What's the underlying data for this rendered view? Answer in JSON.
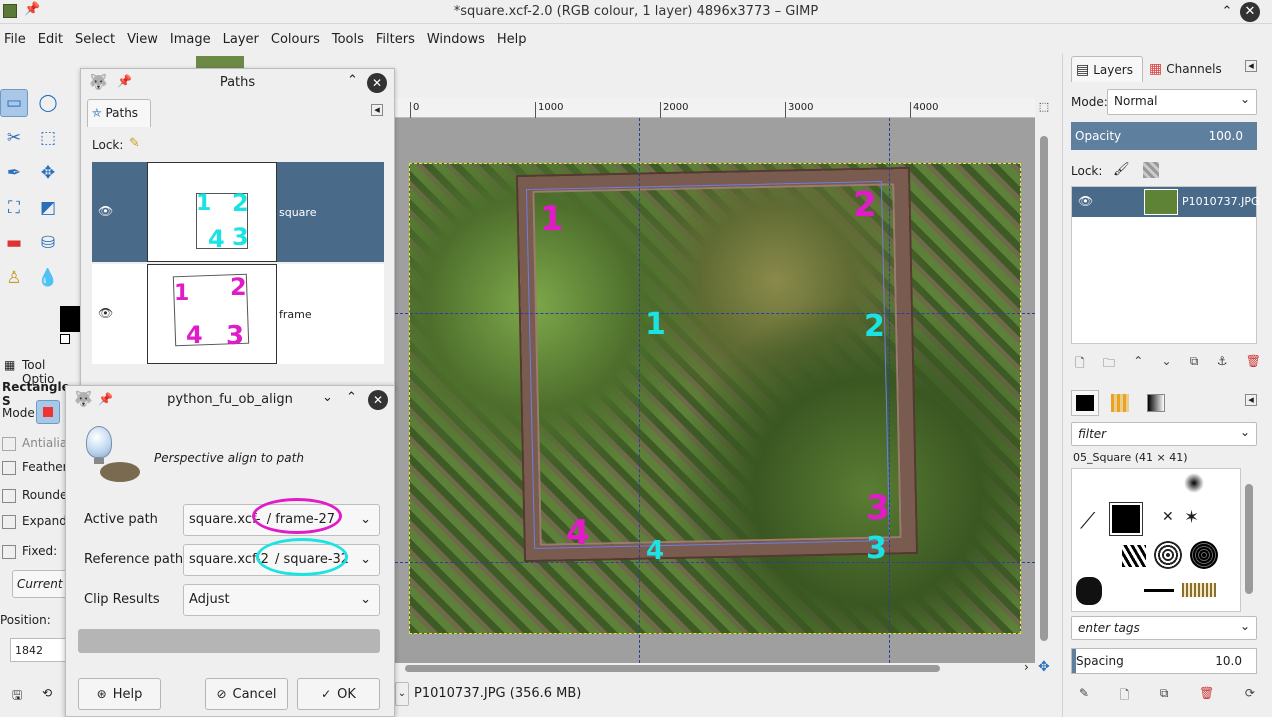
{
  "window": {
    "title": "*square.xcf-2.0 (RGB colour, 1 layer) 4896x3773 – GIMP"
  },
  "menu": [
    "File",
    "Edit",
    "Select",
    "View",
    "Image",
    "Layer",
    "Colours",
    "Tools",
    "Filters",
    "Windows",
    "Help"
  ],
  "ruler": {
    "ticks": [
      "0",
      "1000",
      "2000",
      "3000",
      "4000"
    ]
  },
  "annotations": {
    "magenta": [
      "1",
      "2",
      "3",
      "4"
    ],
    "cyan": [
      "1",
      "2",
      "3",
      "4"
    ]
  },
  "status": {
    "layer_info": "P1010737.JPG (356.6 MB)"
  },
  "paths_dialog": {
    "title": "Paths",
    "tab": "Paths",
    "lock_label": "Lock:",
    "items": [
      {
        "name": "square",
        "thumb_digits": [
          "1",
          "2",
          "4",
          "3"
        ]
      },
      {
        "name": "frame",
        "thumb_digits": [
          "1",
          "2",
          "4",
          "3"
        ]
      }
    ]
  },
  "toolbox": {
    "tool_options_label": "Tool Optio",
    "rect_select_label": "Rectangle S",
    "mode_label": "Mode:",
    "options": [
      "Antialia",
      "Feather",
      "Rounde",
      "Expand",
      "Fixed:"
    ],
    "current_label": "Current",
    "position_label": "Position:",
    "position_value": "1842"
  },
  "plugin_dialog": {
    "title": "python_fu_ob_align",
    "description": "Perspective align to path",
    "active_path_label": "Active path",
    "active_path_prefix": "square.xcf-",
    "active_path_value": "/ frame-27",
    "reference_path_label": "Reference path",
    "reference_path_prefix": "square.xcf-2",
    "reference_path_value": "/ square-32",
    "clip_results_label": "Clip Results",
    "clip_results_value": "Adjust",
    "help_label": "Help",
    "cancel_label": "Cancel",
    "ok_label": "OK"
  },
  "layers_panel": {
    "tab_layers": "Layers",
    "tab_channels": "Channels",
    "mode_label": "Mode:",
    "mode_value": "Normal",
    "opacity_label": "Opacity",
    "opacity_value": "100.0",
    "lock_label": "Lock:",
    "layer_name": "P1010737.JPG"
  },
  "brushes_panel": {
    "filter_placeholder": "filter",
    "brush_name": "05_Square (41 × 41)",
    "tags_placeholder": "enter tags",
    "spacing_label": "Spacing",
    "spacing_value": "10.0"
  },
  "colors": {
    "accent": "#5f7f9f",
    "selection_row": "#4a6a8a",
    "magenta": "#e21bc8",
    "cyan": "#1ce3e3"
  }
}
